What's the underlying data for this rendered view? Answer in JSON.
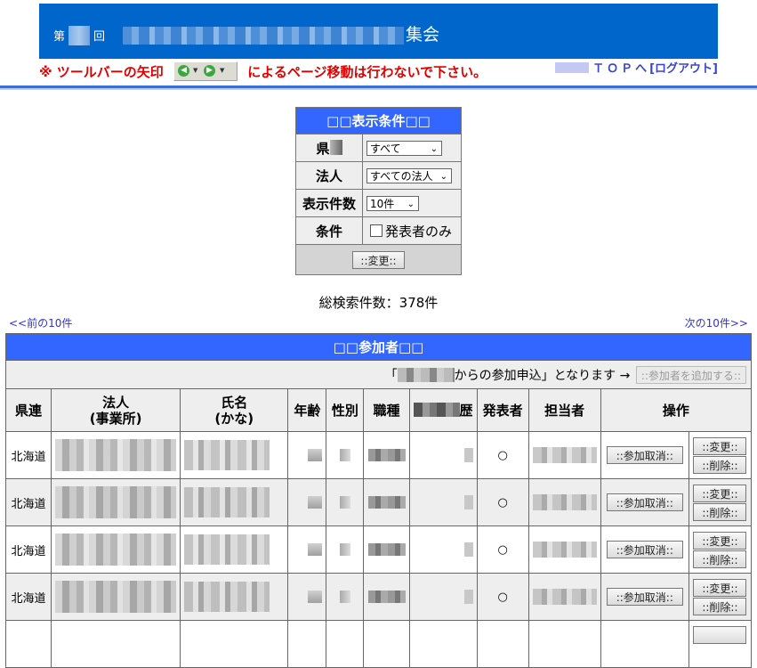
{
  "header": {
    "title_prefix": "第",
    "title_round_suffix": "回",
    "title_suffix": "集会",
    "warning_prefix": "※ ツールバーの矢印",
    "warning_suffix": "によるページ移動は行わないで下さい。",
    "top_link": "ＴＯＰへ",
    "logout_link": "[ログアウト]"
  },
  "conditions": {
    "title": "□□表示条件□□",
    "rows": [
      {
        "label": "県",
        "control": "select",
        "value": "すべて"
      },
      {
        "label": "法人",
        "control": "select",
        "value": "すべての法人"
      },
      {
        "label": "表示件数",
        "control": "select",
        "value": "10件"
      },
      {
        "label": "条件",
        "control": "checkbox",
        "value": "発表者のみ",
        "checked": false
      }
    ],
    "submit_label": "::変更::"
  },
  "results": {
    "total": "総検索件数：378件",
    "prev": "<<前の10件",
    "next": "次の10件>>"
  },
  "participants": {
    "title": "□□参加者□□",
    "note_prefix": "「",
    "note_suffix": "からの参加申込」となります →",
    "add_button": "::参加者を追加する::",
    "columns": [
      "県連",
      "法人\n(事業所)",
      "氏名\n(かな)",
      "年齢",
      "性別",
      "職種",
      "歴",
      "発表者",
      "担当者",
      "操作"
    ],
    "col_labels": {
      "pref": "県連",
      "corp_1": "法人",
      "corp_2": "(事業所)",
      "name_1": "氏名",
      "name_2": "(かな)",
      "age": "年齢",
      "sex": "性別",
      "job": "職種",
      "history_suffix": "歴",
      "presenter": "発表者",
      "staff": "担当者",
      "ops": "操作"
    },
    "rows": [
      {
        "pref": "北海道",
        "presenter": "○",
        "cancel": "::参加取消::",
        "edit": "::変更::",
        "delete": "::削除::"
      },
      {
        "pref": "北海道",
        "presenter": "○",
        "cancel": "::参加取消::",
        "edit": "::変更::",
        "delete": "::削除::"
      },
      {
        "pref": "北海道",
        "presenter": "○",
        "cancel": "::参加取消::",
        "edit": "::変更::",
        "delete": "::削除::"
      },
      {
        "pref": "北海道",
        "presenter": "○",
        "cancel": "::参加取消::",
        "edit": "::変更::",
        "delete": "::削除::"
      }
    ]
  },
  "colors": {
    "banner": "#0066cc",
    "table_header": "#3366ff",
    "warning": "#e00000",
    "link": "#3333cc"
  }
}
